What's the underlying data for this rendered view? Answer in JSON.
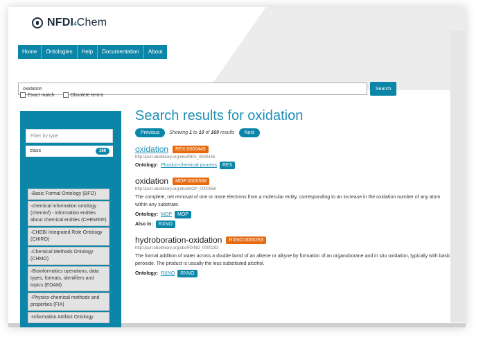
{
  "logo": {
    "brand": "NFDI",
    "dot": "4",
    "suffix": "Chem"
  },
  "nav": [
    "Home",
    "Ontologies",
    "Help",
    "Documentation",
    "About"
  ],
  "search": {
    "value": "oxidation",
    "button": "Search",
    "exact_match": "Exact match",
    "obsolete_terms": "Obsolete terms"
  },
  "sidebar": {
    "filter_placeholder": "Filter by type",
    "type_label": "class",
    "type_count": "169",
    "ontologies": [
      "Basic Formal Ontology (BFO)",
      "chemical information ontology (cheminf) - information entities about chemical entities (CHEMINF)",
      "CHEBI Integrated Role Ontology (CHIRO)",
      "Chemical Methods Ontology (CHMO)",
      "Bioinformatics operations, data types, formats, identifiers and topics (EDAM)",
      "Physico-chemical methods and properties (FIX)",
      "Information Artifact Ontology"
    ]
  },
  "main": {
    "title": "Search results for oxidation",
    "previous": "Previous",
    "next": "Next",
    "showing_prefix": "Showing",
    "showing_from": "1",
    "showing_to_word": "to",
    "showing_to": "10",
    "showing_of_word": "of",
    "showing_total": "169",
    "showing_suffix": "results",
    "ontology_label": "Ontology:",
    "also_in_label": "Also in:",
    "results": [
      {
        "title": "oxidation",
        "id": "REX:0000445",
        "uri": "http://purl.obolibrary.org/obo/REX_0000445",
        "ontology_link": "Physico-chemical process",
        "ontology_tag": "REX"
      },
      {
        "title": "oxidation",
        "id": "MOP:0000568",
        "uri": "http://purl.obolibrary.org/obo/MOP_0000568",
        "description": "The complete, net removal of one or more electrons from a molecular entity, corresponding to an increase in the oxidation number of any atom within any substrate.",
        "ontology_link": "MOP",
        "ontology_tag": "MOP",
        "also_in_tag": "RXNO"
      },
      {
        "title": "hydroboration-oxidation",
        "id": "RXNO:0000293",
        "uri": "http://purl.obolibrary.org/obo/RXNO_0000293",
        "description": "The formal addition of water across a double bond of an alkene or alkyne by formation of an organoborane and in situ oxidation, typically with basic peroxide. The product is usually the less substituted alcohol.",
        "ontology_link": "RXNO",
        "ontology_tag": "RXNO"
      }
    ]
  }
}
